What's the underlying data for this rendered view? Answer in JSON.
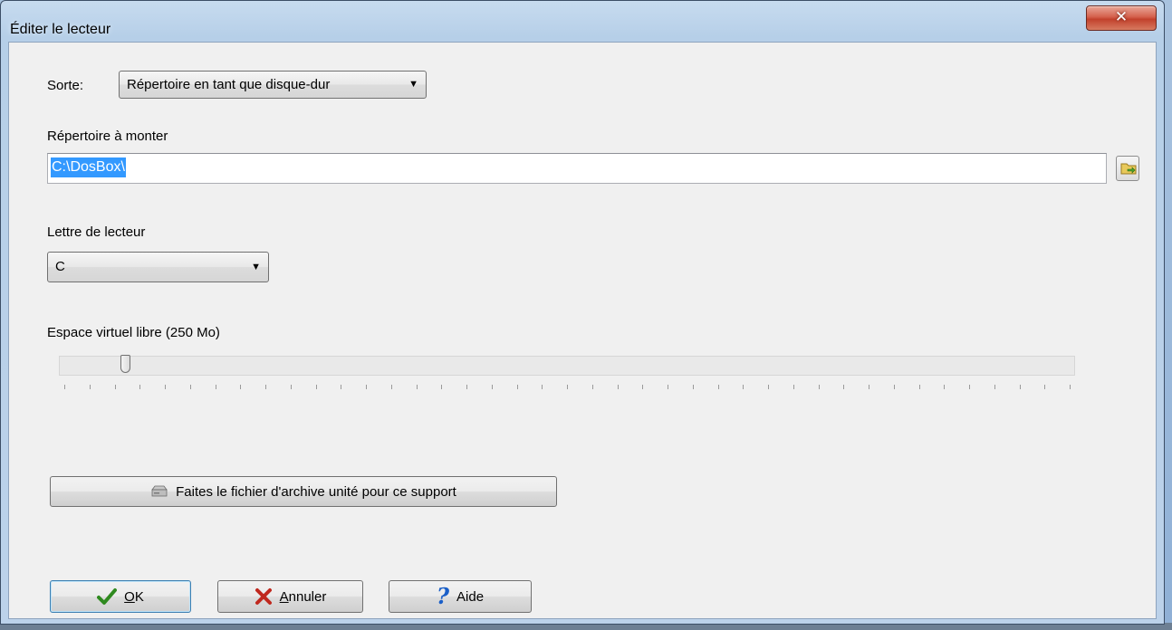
{
  "window": {
    "title": "Éditer le lecteur"
  },
  "kind": {
    "label": "Sorte:",
    "value": "Répertoire en tant que disque-dur"
  },
  "mount_dir": {
    "label": "Répertoire à monter",
    "value": "C:\\DosBox\\"
  },
  "drive_letter": {
    "label": "Lettre de lecteur",
    "value": "C"
  },
  "free_space": {
    "label": "Espace virtuel libre (250 Mo)",
    "slider_fraction": 0.06,
    "tick_count": 40
  },
  "archive_button": {
    "label": "Faites le fichier d'archive unité pour ce support"
  },
  "buttons": {
    "ok": {
      "mnemonic": "O",
      "rest": "K"
    },
    "cancel": {
      "mnemonic": "A",
      "rest": "nnuler"
    },
    "help": {
      "label": "Aide"
    }
  },
  "colors": {
    "selection": "#3399ff",
    "close_button": "#c2412c",
    "help_icon": "#1a5fc8",
    "cancel_icon": "#c0281e",
    "ok_icon": "#2f8a1f"
  },
  "icons": [
    "close-icon",
    "chevron-down-icon",
    "folder-browse-icon",
    "drive-icon",
    "check-icon",
    "x-icon",
    "question-icon"
  ]
}
